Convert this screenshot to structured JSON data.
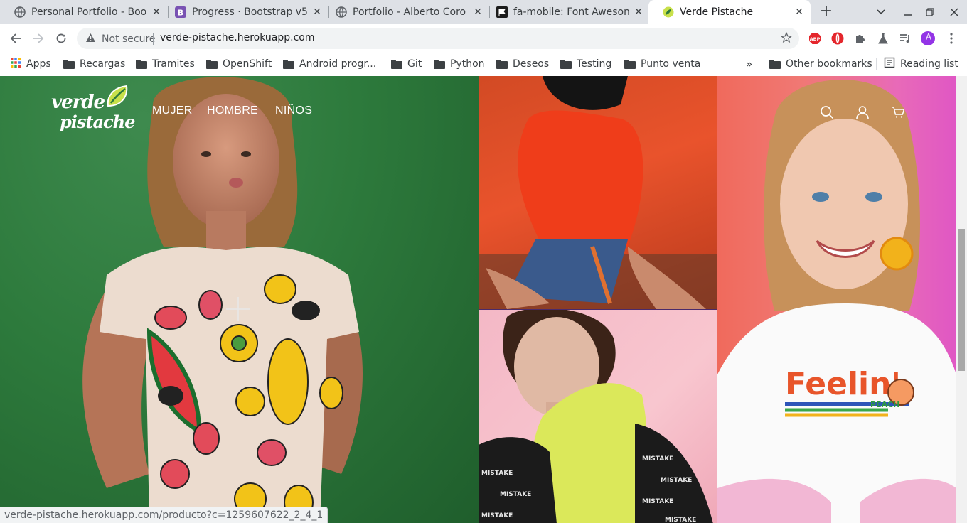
{
  "browser": {
    "tabs": [
      {
        "title": "Personal Portfolio - Boo",
        "favicon": "globe-icon"
      },
      {
        "title": "Progress · Bootstrap v5.",
        "favicon": "bootstrap-icon"
      },
      {
        "title": "Portfolio - Alberto Coro",
        "favicon": "globe-icon"
      },
      {
        "title": "fa-mobile: Font Awesom",
        "favicon": "fontawesome-flag-icon"
      },
      {
        "title": "Verde Pistache",
        "favicon": "verde-pistache-leaf-icon",
        "active": true
      }
    ],
    "new_tab_label": "+",
    "security_label": "Not secure",
    "url": "verde-pistache.herokuapp.com",
    "avatar_letter": "A",
    "bookmarks": [
      {
        "label": "Apps",
        "icon": "apps-grid-icon"
      },
      {
        "label": "Recargas",
        "icon": "folder-icon"
      },
      {
        "label": "Tramites",
        "icon": "folder-icon"
      },
      {
        "label": "OpenShift",
        "icon": "folder-icon"
      },
      {
        "label": "Android progr...",
        "icon": "folder-icon"
      },
      {
        "label": "Git",
        "icon": "folder-icon"
      },
      {
        "label": "Python",
        "icon": "folder-icon"
      },
      {
        "label": "Deseos",
        "icon": "folder-icon"
      },
      {
        "label": "Testing",
        "icon": "folder-icon"
      },
      {
        "label": "Punto venta",
        "icon": "folder-icon"
      }
    ],
    "overflow_label": "»",
    "other_bookmarks": "Other bookmarks",
    "reading_list": "Reading list",
    "status_url": "verde-pistache.herokuapp.com/producto?c=1259607622_2_4_1"
  },
  "site": {
    "logo_line1": "verde",
    "logo_line2": "pistache",
    "nav": [
      "MUJER",
      "HOMBRE",
      "NIÑOS"
    ],
    "header_icons": [
      "search-icon",
      "user-icon",
      "cart-icon"
    ],
    "colors": {
      "accent": "#c8e04a",
      "nav_text": "#ffffff"
    }
  }
}
